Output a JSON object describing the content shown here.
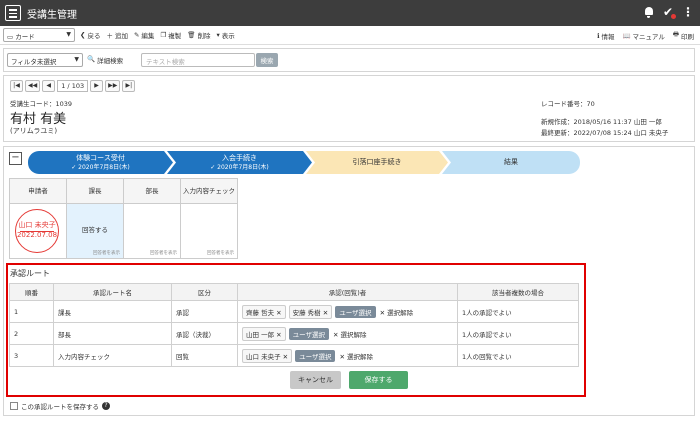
{
  "app": {
    "title": "受講生管理"
  },
  "toolbar": {
    "view_select": "カード",
    "back": "戻る",
    "add": "追加",
    "edit": "編集",
    "copy": "複製",
    "delete": "削除",
    "display": "表示",
    "info": "情報",
    "manual": "マニュアル",
    "print": "印刷"
  },
  "filter": {
    "select": "フィルタ未選択",
    "advanced": "詳細検索",
    "text_placeholder": "テキスト検索",
    "search_button": "検索"
  },
  "pager": {
    "current": "1 / 103"
  },
  "student": {
    "code": "受講生コード：1039",
    "name": "有村 有美",
    "kana": "(アリムラユミ)",
    "record_no": "レコード番号：70",
    "created": "新規作成：2018/05/16 11:37 山田 一郎",
    "updated": "最終更新：2022/07/08 15:24 山口 未央子"
  },
  "workflow": {
    "steps": [
      {
        "label": "体験コース受付",
        "sub": "2020年7月8日(木)"
      },
      {
        "label": "入会手続き",
        "sub": "2020年7月8日(木)"
      },
      {
        "label": "引落口座手続き",
        "sub": ""
      },
      {
        "label": "結果",
        "sub": ""
      }
    ]
  },
  "approval": {
    "headers": [
      "申請者",
      "課長",
      "部長",
      "入力内容チェック"
    ],
    "stamp_name": "山口 未央子",
    "stamp_date": "2022.07.08",
    "answer": "回答する",
    "hide_label": "回答者を表示"
  },
  "route": {
    "title": "承認ルート",
    "headers": [
      "順番",
      "承認ルート名",
      "区分",
      "承認(回覧)者",
      "該当者複数の場合"
    ],
    "rows": [
      {
        "order": "1",
        "name": "課長",
        "kind": "承認",
        "chips": [
          "齊藤 哲夫 ✕",
          "安藤 秀樹 ✕"
        ],
        "multi": "1人の承認でよい"
      },
      {
        "order": "2",
        "name": "部長",
        "kind": "承認（決裁）",
        "chips": [
          "山田 一郎 ✕"
        ],
        "multi": "1人の承認でよい"
      },
      {
        "order": "3",
        "name": "入力内容チェック",
        "kind": "回覧",
        "chips": [
          "山口 未央子 ✕"
        ],
        "multi": "1人の回覧でよい"
      }
    ],
    "user_select": "ユーザ選択",
    "clear": "✕ 選択解除",
    "cancel": "キャンセル",
    "save": "保存する"
  },
  "save_route": {
    "label": "この承認ルートを保存する"
  }
}
